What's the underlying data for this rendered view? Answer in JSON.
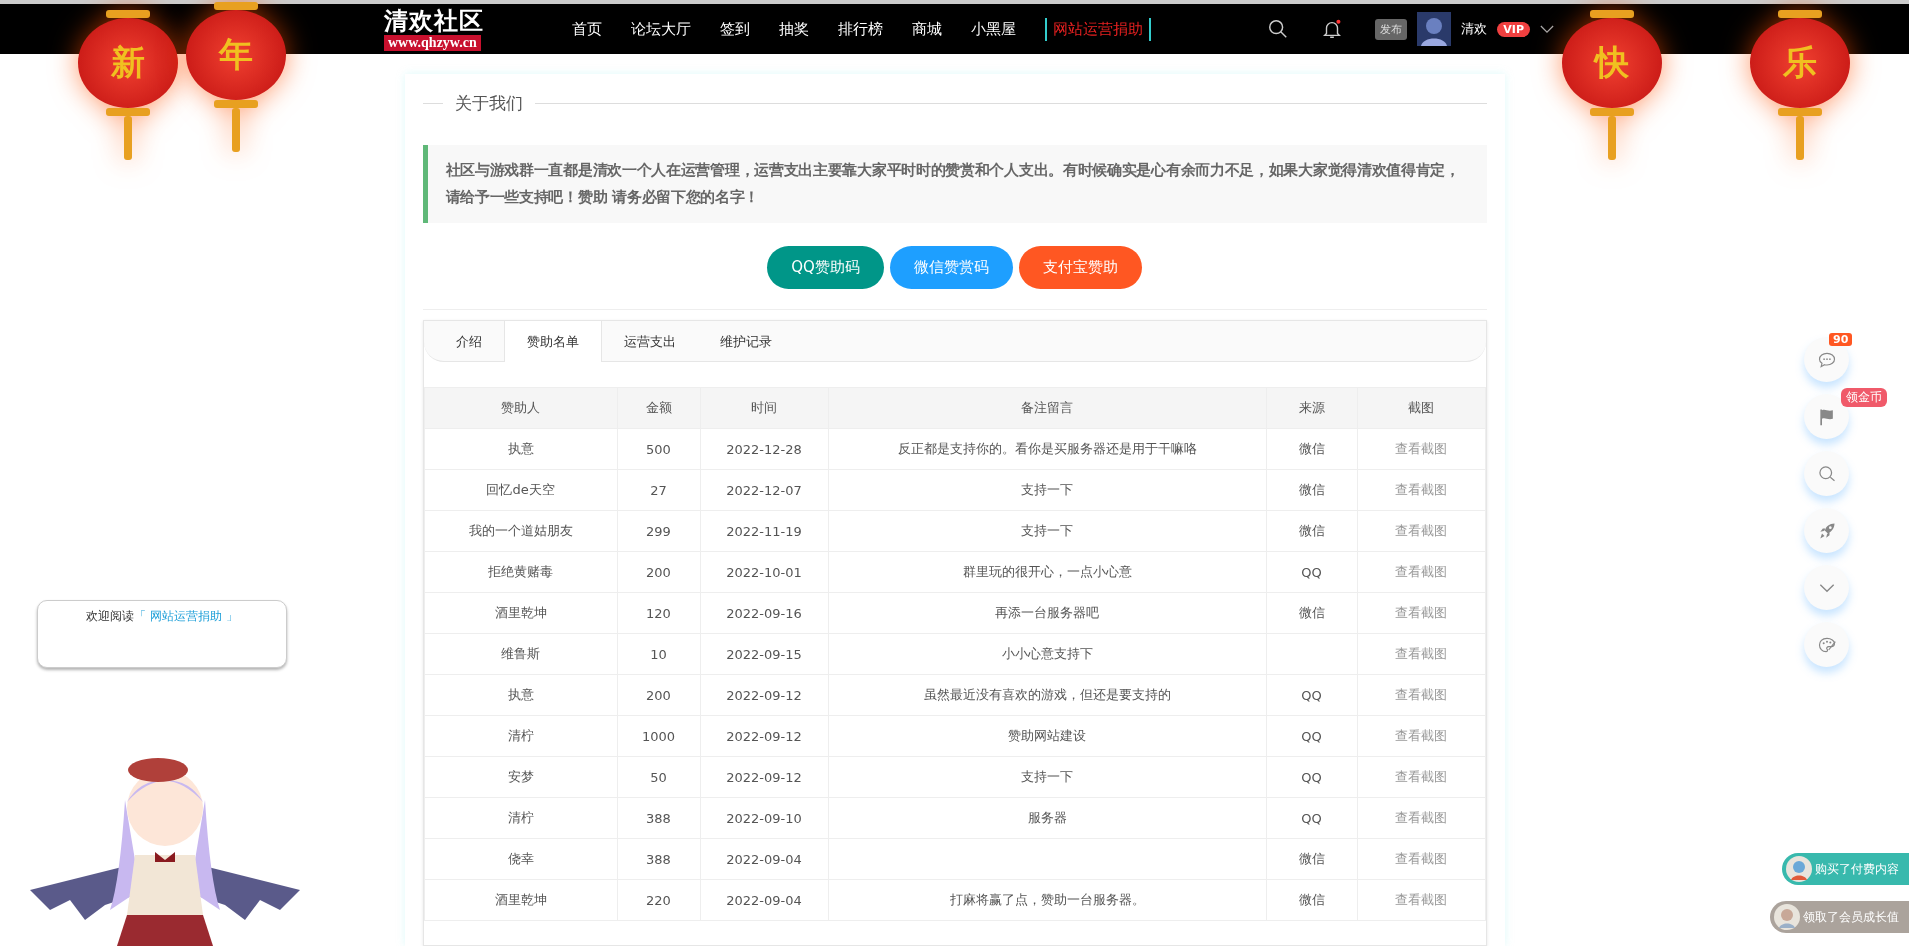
{
  "header": {
    "logo": {
      "title": "清欢社区",
      "url": "www.qhzyw.cn"
    },
    "nav": [
      {
        "label": "首页",
        "kind": "plain"
      },
      {
        "label": "论坛大厅",
        "kind": "plain"
      },
      {
        "label": "签到",
        "kind": "plain"
      },
      {
        "label": "抽奖",
        "kind": "plain"
      },
      {
        "label": "排行榜",
        "kind": "plain"
      },
      {
        "label": "商城",
        "kind": "plain"
      },
      {
        "label": "小黑屋",
        "kind": "plain"
      },
      {
        "label": "网站运营捐助",
        "kind": "highlight"
      }
    ],
    "notification_dot": true,
    "publish": "发布",
    "user": {
      "name": "清欢",
      "badge": "VIP"
    }
  },
  "lanterns": [
    "新",
    "年",
    "快",
    "乐"
  ],
  "page": {
    "section_title": "关于我们",
    "notice": "社区与游戏群一直都是清欢一个人在运营管理，运营支出主要靠大家平时时的赞赏和个人支出。有时候确实是心有余而力不足，如果大家觉得清欢值得肯定，请给予一些支持吧！赞助 请务必留下您的名字！",
    "donate_buttons": [
      {
        "label": "QQ赞助码",
        "color": "#009688"
      },
      {
        "label": "微信赞赏码",
        "color": "#1e9fff"
      },
      {
        "label": "支付宝赞助",
        "color": "#ff5722"
      }
    ],
    "tabs": [
      {
        "label": "介绍",
        "selected": false
      },
      {
        "label": "赞助名单",
        "selected": true
      },
      {
        "label": "运营支出",
        "selected": false
      },
      {
        "label": "维护记录",
        "selected": false
      }
    ],
    "table": {
      "columns": [
        "赞助人",
        "金额",
        "时间",
        "备注留言",
        "来源",
        "截图"
      ],
      "rows": [
        {
          "name": "执意",
          "amount": "500",
          "date": "2022-12-28",
          "note": "反正都是支持你的。看你是买服务器还是用于干嘛咯",
          "source": "微信",
          "link": "查看截图"
        },
        {
          "name": "回忆de天空",
          "amount": "27",
          "date": "2022-12-07",
          "note": "支持一下",
          "source": "微信",
          "link": "查看截图"
        },
        {
          "name": "我的一个道姑朋友",
          "amount": "299",
          "date": "2022-11-19",
          "note": "支持一下",
          "source": "微信",
          "link": "查看截图"
        },
        {
          "name": "拒绝黄赌毒",
          "amount": "200",
          "date": "2022-10-01",
          "note": "群里玩的很开心，一点小心意",
          "source": "QQ",
          "link": "查看截图"
        },
        {
          "name": "酒里乾坤",
          "amount": "120",
          "date": "2022-09-16",
          "note": "再添一台服务器吧",
          "source": "微信",
          "link": "查看截图"
        },
        {
          "name": "维鲁斯",
          "amount": "10",
          "date": "2022-09-15",
          "note": "小小心意支持下",
          "link": "查看截图"
        },
        {
          "name": "执意",
          "amount": "200",
          "date": "2022-09-12",
          "note": "虽然最近没有喜欢的游戏，但还是要支持的",
          "source": "QQ",
          "link": "查看截图"
        },
        {
          "name": "清柠",
          "amount": "1000",
          "date": "2022-09-12",
          "note": "赞助网站建设",
          "source": "QQ",
          "link": "查看截图"
        },
        {
          "name": "安梦",
          "amount": "50",
          "date": "2022-09-12",
          "note": "支持一下",
          "source": "QQ",
          "link": "查看截图"
        },
        {
          "name": "清柠",
          "amount": "388",
          "date": "2022-09-10",
          "note": "服务器",
          "source": "QQ",
          "link": "查看截图"
        },
        {
          "name": "侥幸",
          "amount": "388",
          "date": "2022-09-04",
          "source": "微信",
          "link": "查看截图"
        },
        {
          "name": "酒里乾坤",
          "amount": "220",
          "date": "2022-09-04",
          "note": "打麻将赢了点，赞助一台服务器。",
          "source": "微信",
          "link": "查看截图"
        }
      ]
    }
  },
  "welcome": {
    "text": "欢迎阅读",
    "link": "「 网站运营捐助 」"
  },
  "side_tools": [
    {
      "kind": "comment",
      "badge": "90"
    },
    {
      "kind": "flag",
      "tip": "领金币"
    },
    {
      "kind": "search"
    },
    {
      "kind": "rocket"
    },
    {
      "kind": "down"
    },
    {
      "kind": "palette"
    }
  ],
  "toasts": [
    {
      "text": "购买了付费内容",
      "color": "#38b9ad"
    },
    {
      "text": "领取了会员成长值",
      "color": "#aba39c"
    }
  ]
}
